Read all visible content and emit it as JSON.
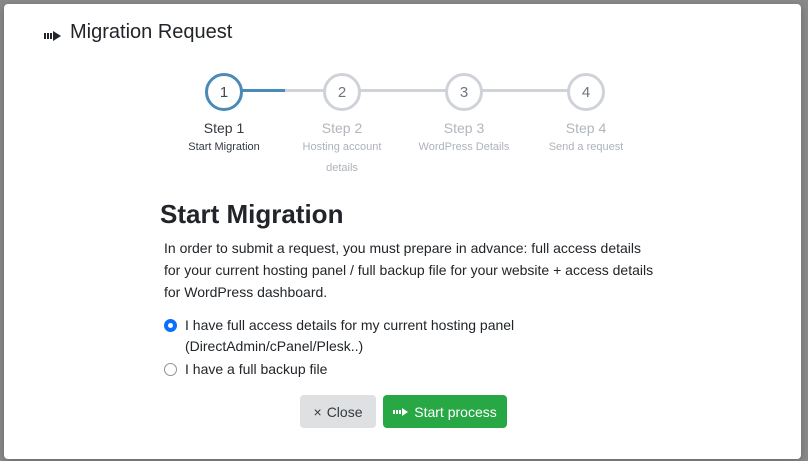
{
  "modal": {
    "title": "Migration Request",
    "title_icon": "arrow-right-icon"
  },
  "steps": [
    {
      "number": "1",
      "title": "Step 1",
      "subtitle": "Start Migration",
      "active": true
    },
    {
      "number": "2",
      "title": "Step 2",
      "subtitle": "Hosting account details",
      "active": false
    },
    {
      "number": "3",
      "title": "Step 3",
      "subtitle": "WordPress Details",
      "active": false
    },
    {
      "number": "4",
      "title": "Step 4",
      "subtitle": "Send a request",
      "active": false
    }
  ],
  "content": {
    "heading": "Start Migration",
    "description": "In order to submit a request, you must prepare in advance: full access details for your current hosting panel / full backup file for your website + access details for WordPress dashboard.",
    "options": [
      {
        "label": "I have full access details for my current hosting panel (DirectAdmin/cPanel/Plesk..)",
        "selected": true
      },
      {
        "label": "I have a full backup file",
        "selected": false
      }
    ]
  },
  "buttons": {
    "close_icon": "×",
    "close_label": "Close",
    "start_icon": "arrow-right-icon",
    "start_label": "Start process"
  },
  "colors": {
    "accent": "#4a8ab8",
    "primary": "#0d6efd",
    "success": "#28a745",
    "muted": "#dfe0e2"
  }
}
